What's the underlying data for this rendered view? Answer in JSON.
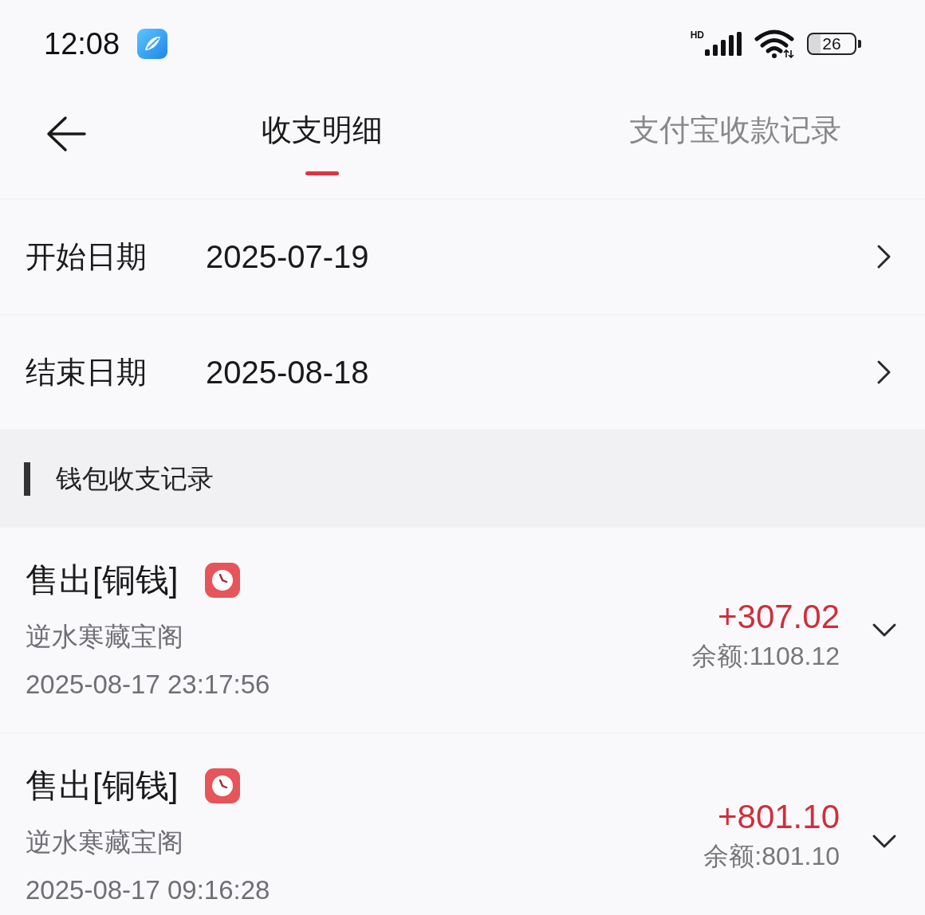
{
  "status_bar": {
    "time": "12:08",
    "network_type": "HD",
    "battery": "26"
  },
  "header": {
    "tabs": [
      {
        "label": "收支明细",
        "selected": true
      },
      {
        "label": "支付宝收款记录",
        "selected": false
      }
    ]
  },
  "date_filters": [
    {
      "label": "开始日期",
      "value": "2025-07-19"
    },
    {
      "label": "结束日期",
      "value": "2025-08-18"
    }
  ],
  "section": {
    "title": "钱包收支记录"
  },
  "records": [
    {
      "title": "售出[铜钱]",
      "source": "逆水寒藏宝阁",
      "time": "2025-08-17 23:17:56",
      "amount": "+307.02",
      "balance": "余额:1108.12"
    },
    {
      "title": "售出[铜钱]",
      "source": "逆水寒藏宝阁",
      "time": "2025-08-17 09:16:28",
      "amount": "+801.10",
      "balance": "余额:801.10"
    }
  ]
}
